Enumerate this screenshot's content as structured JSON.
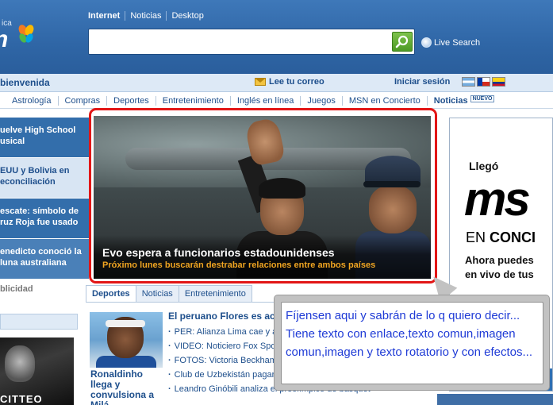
{
  "header": {
    "logo_sub": "ica",
    "logo_text": "n",
    "search_tabs": [
      "Internet",
      "Noticias",
      "Desktop"
    ],
    "search_value": "",
    "live_search_label": "Live Search"
  },
  "welcome_bar": {
    "welcome": "bienvenida",
    "mail_label": "Lee tu correo",
    "signin_label": "Iniciar sesión"
  },
  "nav": {
    "items": [
      "Astrología",
      "Compras",
      "Deportes",
      "Entretenimiento",
      "Inglés en línea",
      "Juegos",
      "MSN en Concierto",
      "Noticias"
    ],
    "new_badge": "NUEVO"
  },
  "left_col": {
    "items": [
      "uelve High School usical",
      "EUU y Bolivia en econciliación",
      "escate: símbolo de ruz Roja fue usado",
      "enedicto conoció la luna australiana"
    ],
    "publicidad": "blicidad",
    "photo_text": "CITTEO"
  },
  "hero": {
    "title": "Evo espera a funcionarios estadounidenses",
    "subtitle": "Próximo lunes buscarán destrabar relaciones entre ambos países"
  },
  "tabs": [
    "Deportes",
    "Noticias",
    "Entretenimiento"
  ],
  "news": {
    "photo_caption": "Ronaldinho llega y convulsiona a Milá",
    "headline": "El peruano Flores es acu",
    "items": [
      "PER: Alianza Lima cae y af",
      "VIDEO: Noticiero Fox Spor",
      "FOTOS: Victoria Beckham,",
      "Club de Uzbekistán pagarí",
      "Leandro Ginóbili analiza el preolímpico de básquet"
    ]
  },
  "ad": {
    "llego": "Llegó",
    "msn": "ms",
    "en": "EN",
    "concierto": "CONCI",
    "line1": "Ahora puedes",
    "line2": "en vivo de tus"
  },
  "callout": {
    "lines": [
      "Fíjensen aqui y sabrán de lo q quiero decir...",
      "Tiene texto con enlace,texto comun,imagen",
      "comun,imagen y texto rotatorio y con efectos..."
    ]
  }
}
